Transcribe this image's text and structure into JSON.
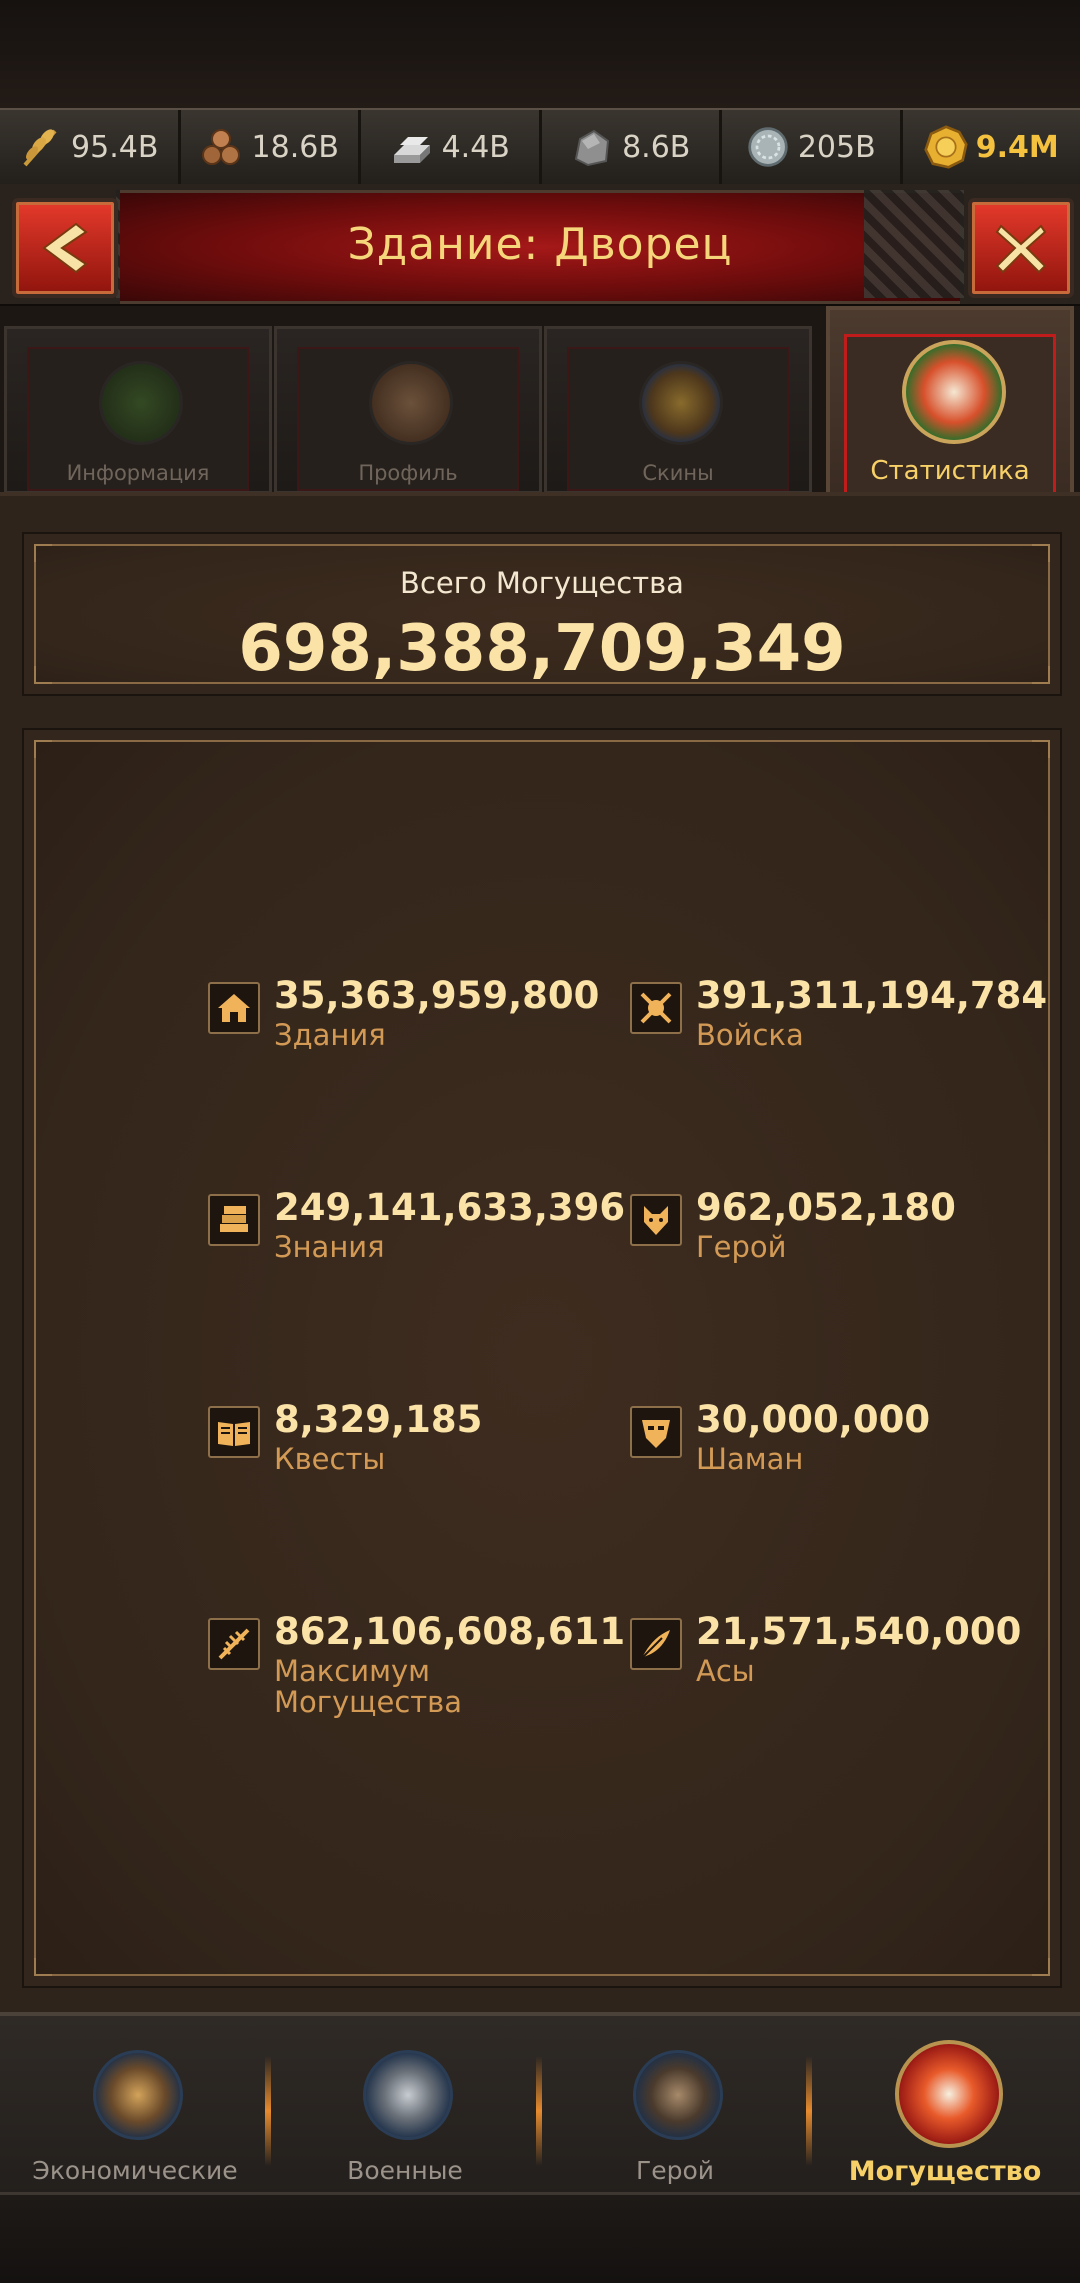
{
  "resources": [
    {
      "icon": "wheat-icon",
      "value": "95.4B"
    },
    {
      "icon": "wood-logs-icon",
      "value": "18.6B"
    },
    {
      "icon": "iron-ingot-icon",
      "value": "4.4B"
    },
    {
      "icon": "stone-icon",
      "value": "8.6B"
    },
    {
      "icon": "silver-coin-icon",
      "value": "205B"
    },
    {
      "icon": "gold-coin-icon",
      "value": "9.4M"
    }
  ],
  "header": {
    "back_label": "<",
    "title": "Здание: Дворец",
    "close_label": "X"
  },
  "tabs": [
    {
      "label": "Информация",
      "icon": "info-icon",
      "active": false
    },
    {
      "label": "Профиль",
      "icon": "profile-scroll-icon",
      "active": false
    },
    {
      "label": "Скины",
      "icon": "skins-tower-icon",
      "active": false
    },
    {
      "label": "Статистика",
      "icon": "statistics-icon",
      "active": true
    }
  ],
  "power": {
    "label": "Всего Могущества",
    "value": "698,388,709,349"
  },
  "stats": [
    {
      "icon": "house-icon",
      "value": "35,363,959,800",
      "label": "Здания"
    },
    {
      "icon": "troops-icon",
      "value": "391,311,194,784",
      "label": "Войска"
    },
    {
      "icon": "books-icon",
      "value": "249,141,633,396",
      "label": "Знания"
    },
    {
      "icon": "hero-wolf-icon",
      "value": "962,052,180",
      "label": "Герой"
    },
    {
      "icon": "open-book-icon",
      "value": "8,329,185",
      "label": "Квесты"
    },
    {
      "icon": "shaman-mask-icon",
      "value": "30,000,000",
      "label": "Шаман"
    },
    {
      "icon": "max-power-icon",
      "value": "862,106,608,611",
      "label": "Максимум Могущества"
    },
    {
      "icon": "aces-feather-icon",
      "value": "21,571,540,000",
      "label": "Асы"
    }
  ],
  "bottom_nav": [
    {
      "label": "Экономические",
      "icon": "economy-scales-icon",
      "active": false
    },
    {
      "label": "Военные",
      "icon": "military-swords-icon",
      "active": false
    },
    {
      "label": "Герой",
      "icon": "hero-portrait-icon",
      "active": false
    },
    {
      "label": "Могущество",
      "icon": "power-sword-icon",
      "active": true
    }
  ],
  "colors": {
    "accent_gold": "#fbe3a8",
    "label_orange": "#d39a55",
    "active_tab_gold": "#f7d067",
    "banner_red": "#a51818"
  }
}
